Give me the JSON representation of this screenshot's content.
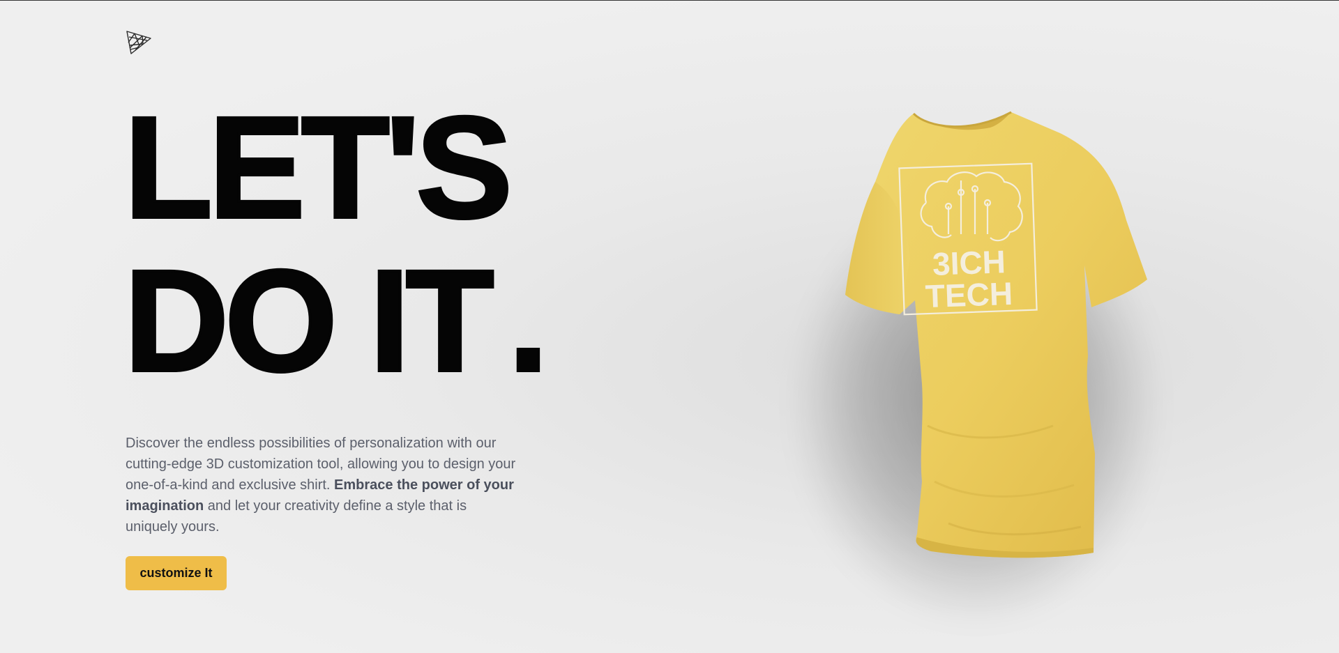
{
  "logo": {
    "icon": "triangle-mesh-icon"
  },
  "hero": {
    "headline_line1": "LET'S",
    "headline_line2": "DO IT",
    "headline_dot": "."
  },
  "description": {
    "part1": "Discover the endless possibilities of personalization with our cutting-edge 3D customization tool, allowing you to design your one-of-a-kind and exclusive shirt. ",
    "bold": "Embrace the power of your imagination",
    "part2": " and let your creativity define a style that is uniquely yours."
  },
  "cta": {
    "label": "customize It"
  },
  "shirt": {
    "color": "#eccd5e",
    "logo_text_line1": "3ICH",
    "logo_text_line2": "TECH",
    "logo_color": "#f4eedd"
  },
  "colors": {
    "accent": "#efbd48",
    "text_dark": "#050505",
    "text_muted": "#5b5f6b"
  }
}
